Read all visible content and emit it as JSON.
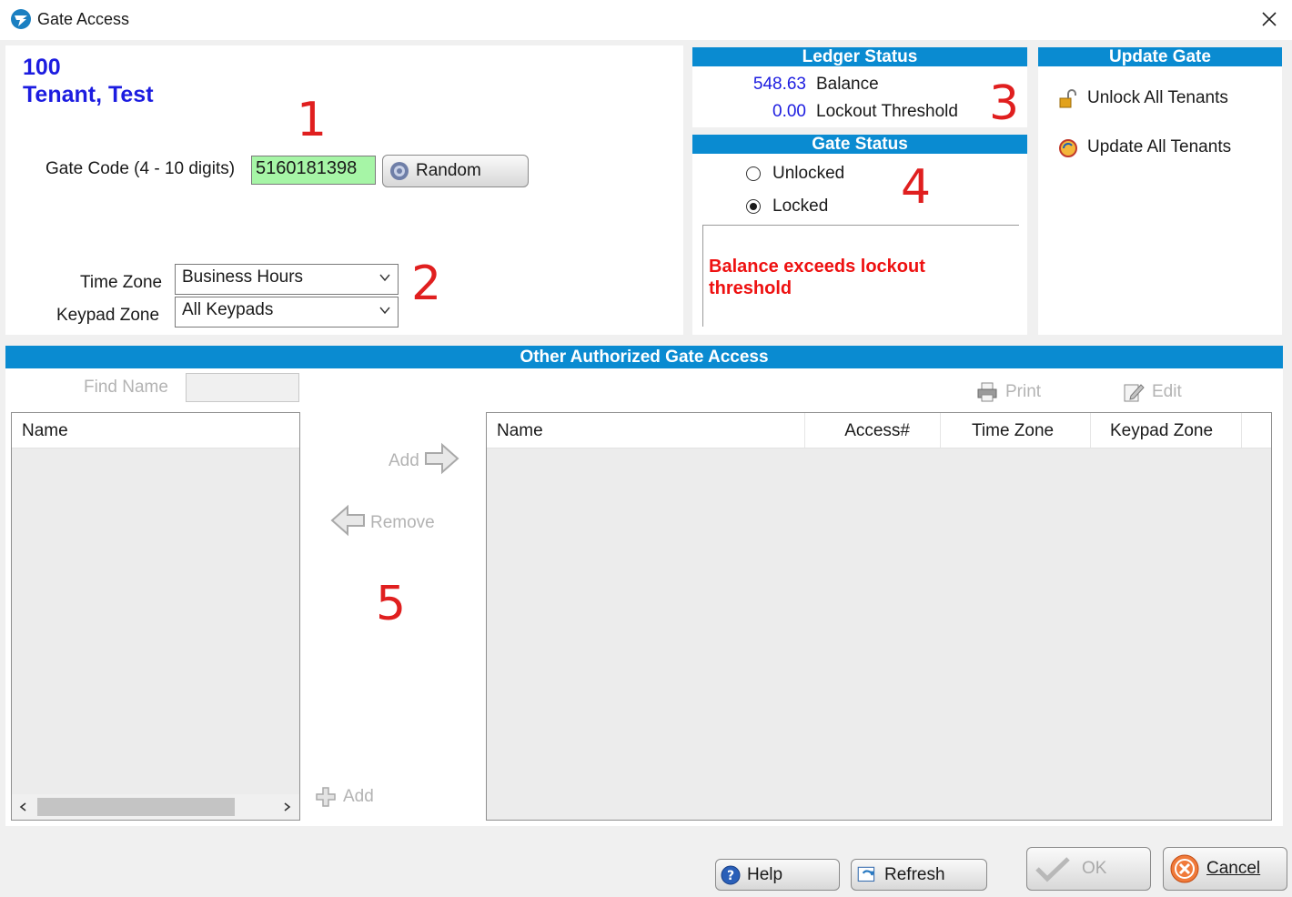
{
  "window": {
    "title": "Gate Access",
    "app_icon": "app-logo-icon",
    "close_icon": "close-icon"
  },
  "tenant": {
    "unit": "100",
    "name": "Tenant, Test"
  },
  "gate_code": {
    "label": "Gate Code (4 - 10 digits)",
    "value": "5160181398",
    "random_label": "Random",
    "random_icon": "gear-icon"
  },
  "zones": {
    "time_zone_label": "Time Zone",
    "time_zone_value": "Business Hours",
    "keypad_zone_label": "Keypad Zone",
    "keypad_zone_value": "All Keypads"
  },
  "ledger_status": {
    "header": "Ledger Status",
    "balance_value": "548.63",
    "balance_label": "Balance",
    "threshold_value": "0.00",
    "threshold_label": "Lockout Threshold"
  },
  "gate_status": {
    "header": "Gate Status",
    "options": [
      "Unlocked",
      "Locked"
    ],
    "selected": "Locked",
    "message": "Balance exceeds lockout threshold"
  },
  "update_gate": {
    "header": "Update Gate",
    "unlock_all_label": "Unlock All Tenants",
    "update_all_label": "Update All Tenants"
  },
  "other_access": {
    "header": "Other Authorized Gate Access",
    "find_name_label": "Find Name",
    "find_name_value": "",
    "left_list_header": "Name",
    "add_arrow_label": "Add",
    "remove_label": "Remove",
    "add_label": "Add",
    "print_label": "Print",
    "edit_label": "Edit",
    "columns": [
      "Name",
      "Access#",
      "Time Zone",
      "Keypad Zone"
    ]
  },
  "footer": {
    "help_label": "Help",
    "refresh_label": "Refresh",
    "ok_label": "OK",
    "cancel_label": "Cancel"
  },
  "annotations": [
    "1",
    "2",
    "3",
    "4",
    "5"
  ],
  "colors": {
    "header_blue": "#0a8bd1",
    "tenant_blue": "#1c1ce0",
    "alert_red": "#ee1111",
    "annotation_red": "#e01f1f",
    "gate_code_green": "#a6f5a6"
  }
}
